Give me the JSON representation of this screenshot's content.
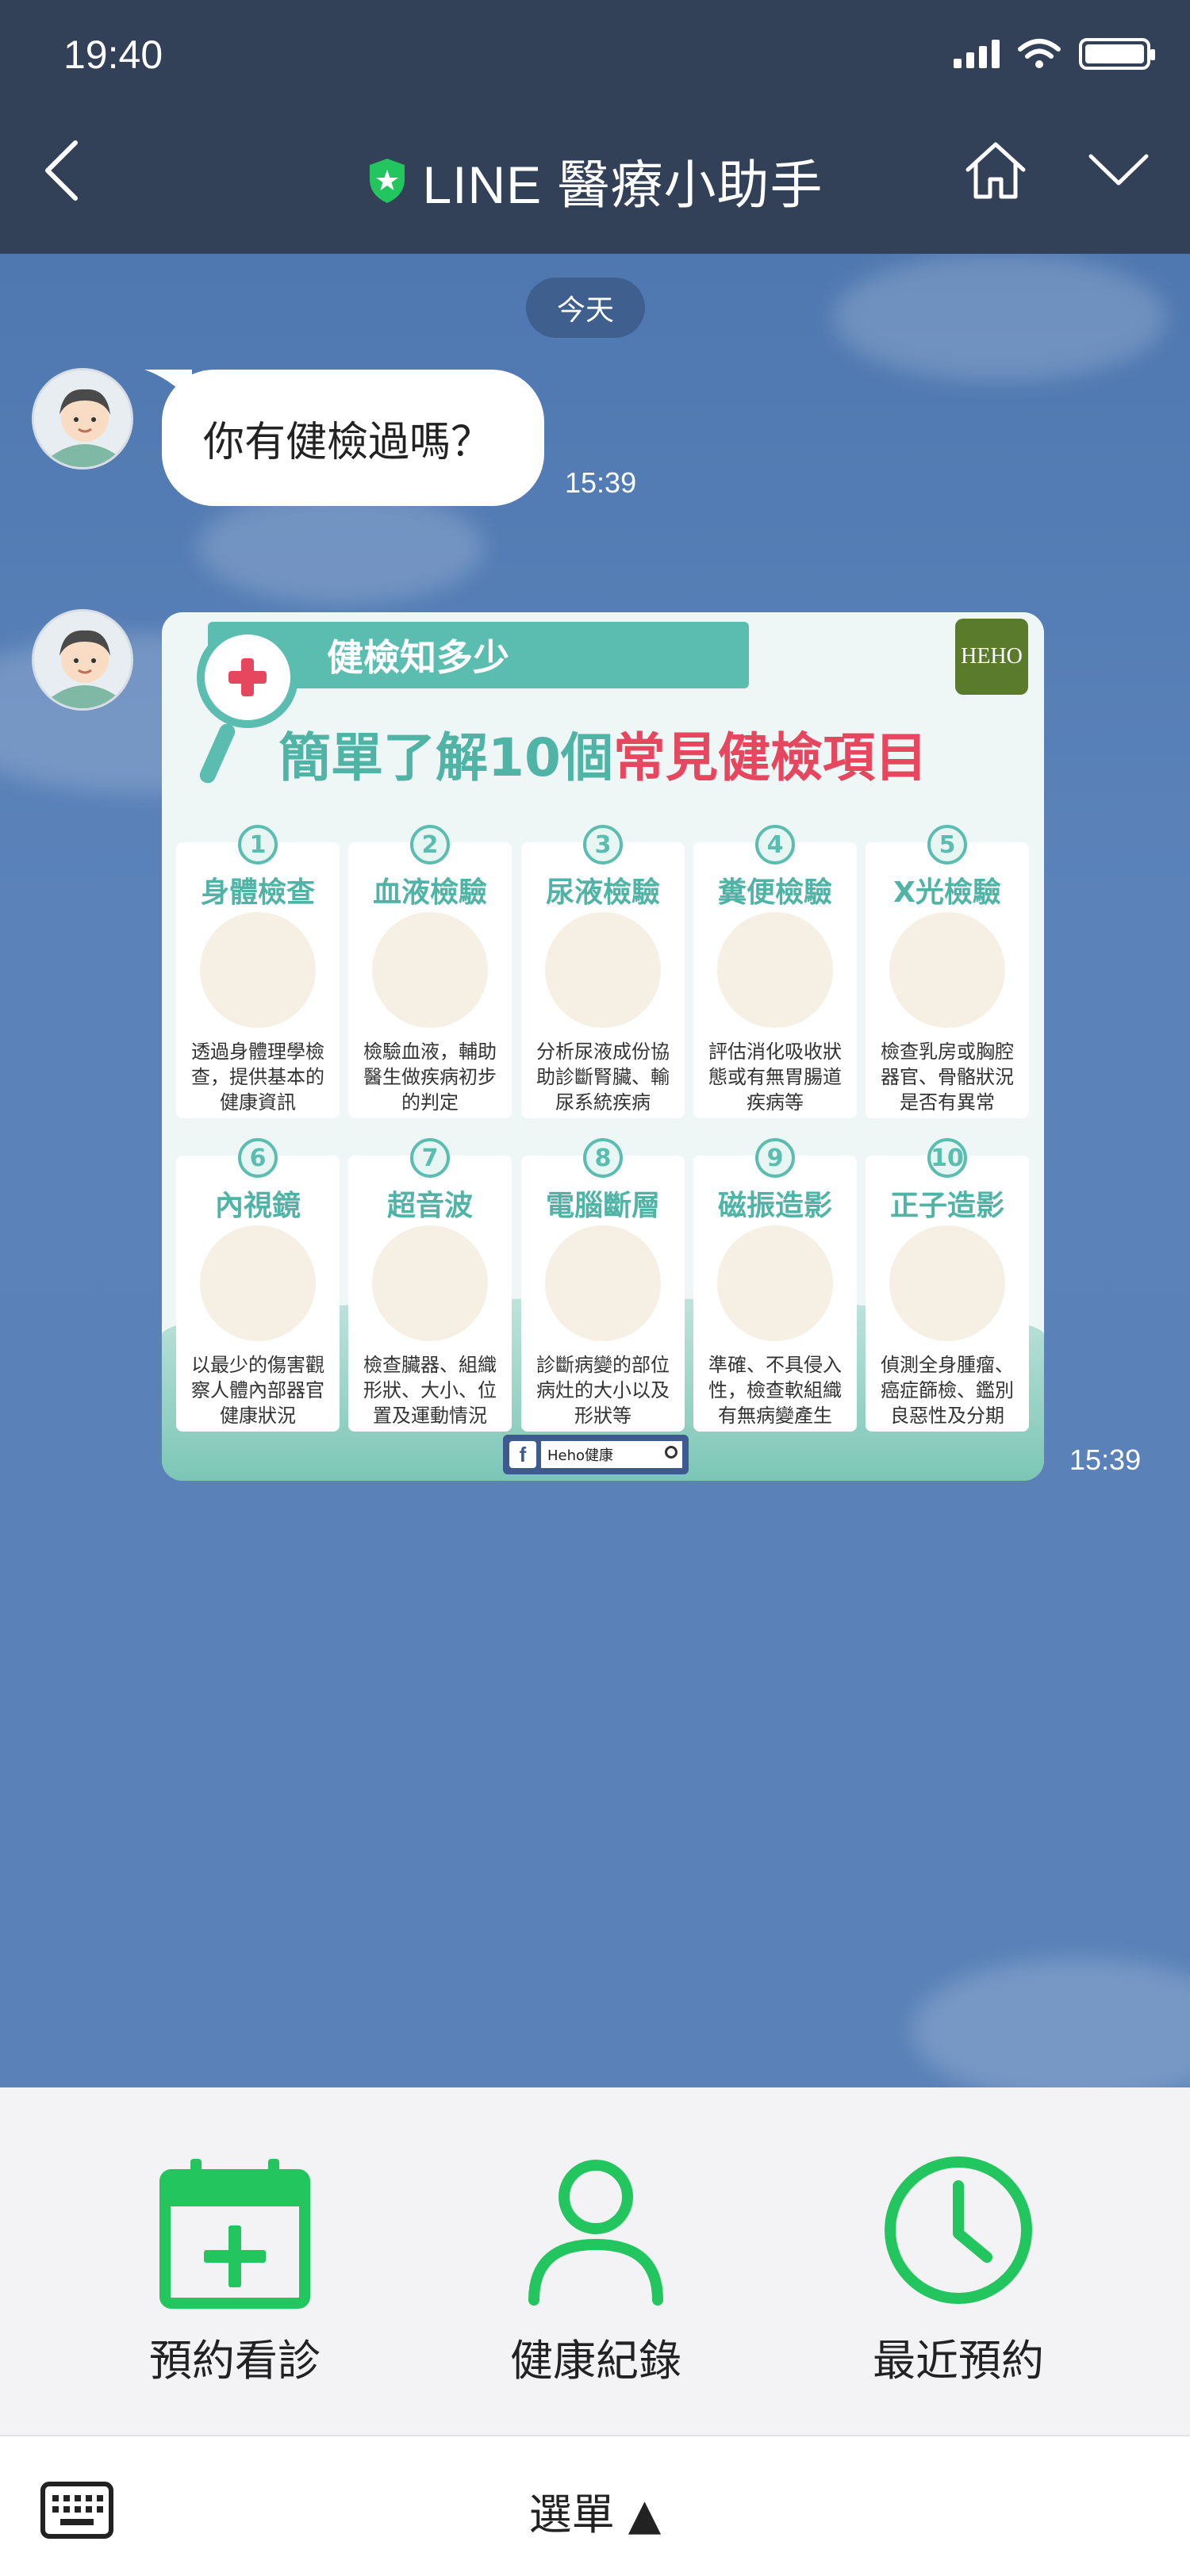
{
  "status": {
    "time": "19:40"
  },
  "header": {
    "title": "LINE 醫療小助手",
    "icons": [
      "back-chevron-icon",
      "verified-shield-icon",
      "home-icon",
      "chevron-down-icon"
    ]
  },
  "chat": {
    "date_label": "今天",
    "messages": [
      {
        "type": "text",
        "text": "你有健檢過嗎？",
        "time": "15:39"
      },
      {
        "type": "image",
        "time": "15:39"
      }
    ]
  },
  "poster": {
    "banner": "健檢知多少",
    "brand": "HEHO",
    "subtitle_a": "簡單了解10個",
    "subtitle_b": "常見健檢項目",
    "items": [
      {
        "num": "1",
        "title": "身體檢查",
        "desc": "透過身體理學檢查，提供基本的健康資訊"
      },
      {
        "num": "2",
        "title": "血液檢驗",
        "desc": "檢驗血液，輔助醫生做疾病初步的判定"
      },
      {
        "num": "3",
        "title": "尿液檢驗",
        "desc": "分析尿液成份協助診斷腎臟、輸尿系統疾病"
      },
      {
        "num": "4",
        "title": "糞便檢驗",
        "desc": "評估消化吸收狀態或有無胃腸道疾病等"
      },
      {
        "num": "5",
        "title": "X光檢驗",
        "desc": "檢查乳房或胸腔器官、骨骼狀況是否有異常"
      },
      {
        "num": "6",
        "title": "內視鏡",
        "desc": "以最少的傷害觀察人體內部器官健康狀況"
      },
      {
        "num": "7",
        "title": "超音波",
        "desc": "檢查臟器、組織形狀、大小、位置及運動情況"
      },
      {
        "num": "8",
        "title": "電腦斷層",
        "desc": "診斷病變的部位病灶的大小以及形狀等"
      },
      {
        "num": "9",
        "title": "磁振造影",
        "desc": "準確、不具侵入性，檢查軟組織有無病變產生"
      },
      {
        "num": "10",
        "title": "正子造影",
        "desc": "偵測全身腫瘤、癌症篩檢、鑑別良惡性及分期"
      }
    ],
    "search_text": "Heho健康"
  },
  "rich_menu": {
    "items": [
      {
        "label": "預約看診",
        "icon": "calendar-add-icon"
      },
      {
        "label": "健康紀錄",
        "icon": "person-icon"
      },
      {
        "label": "最近預約",
        "icon": "clock-icon"
      }
    ],
    "accent": "#22c55e"
  },
  "bottom_bar": {
    "menu_label": "選單 ▲",
    "keyboard_icon": "keyboard-icon"
  }
}
